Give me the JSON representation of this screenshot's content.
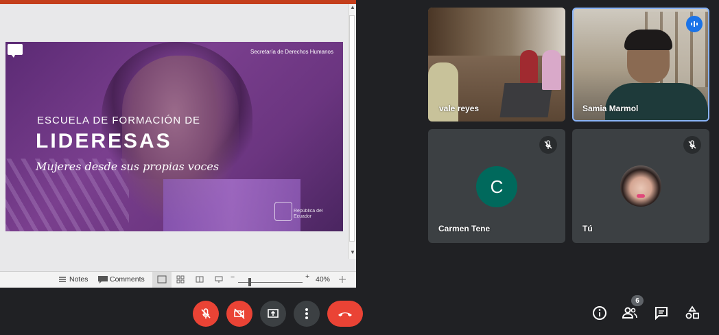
{
  "presentation": {
    "slide": {
      "org": "Secretaría de Derechos Humanos",
      "line1": "ESCUELA DE FORMACIÓN DE",
      "line2": "LIDERESAS",
      "line3": "Mujeres desde sus propias voces",
      "logo_text": "República del Ecuador"
    },
    "statusbar": {
      "notes_label": "Notes",
      "comments_label": "Comments",
      "zoom_minus": "−",
      "zoom_plus": "+",
      "zoom_level": "40%"
    }
  },
  "participants": [
    {
      "name": "vale reyes",
      "type": "video",
      "speaking": false
    },
    {
      "name": "Samia Marmol",
      "type": "video",
      "speaking": true
    },
    {
      "name": "Carmen Tene",
      "type": "avatar",
      "initial": "C",
      "avatar_color": "#00695c",
      "muted": true
    },
    {
      "name": "Tú",
      "type": "photo",
      "muted": true
    }
  ],
  "controls": {
    "people_count": "6"
  },
  "colors": {
    "background": "#202124",
    "tile": "#3c4043",
    "danger": "#ea4335",
    "speaking_border": "#8ab4f8",
    "accent_bar": "#c43e1c"
  }
}
